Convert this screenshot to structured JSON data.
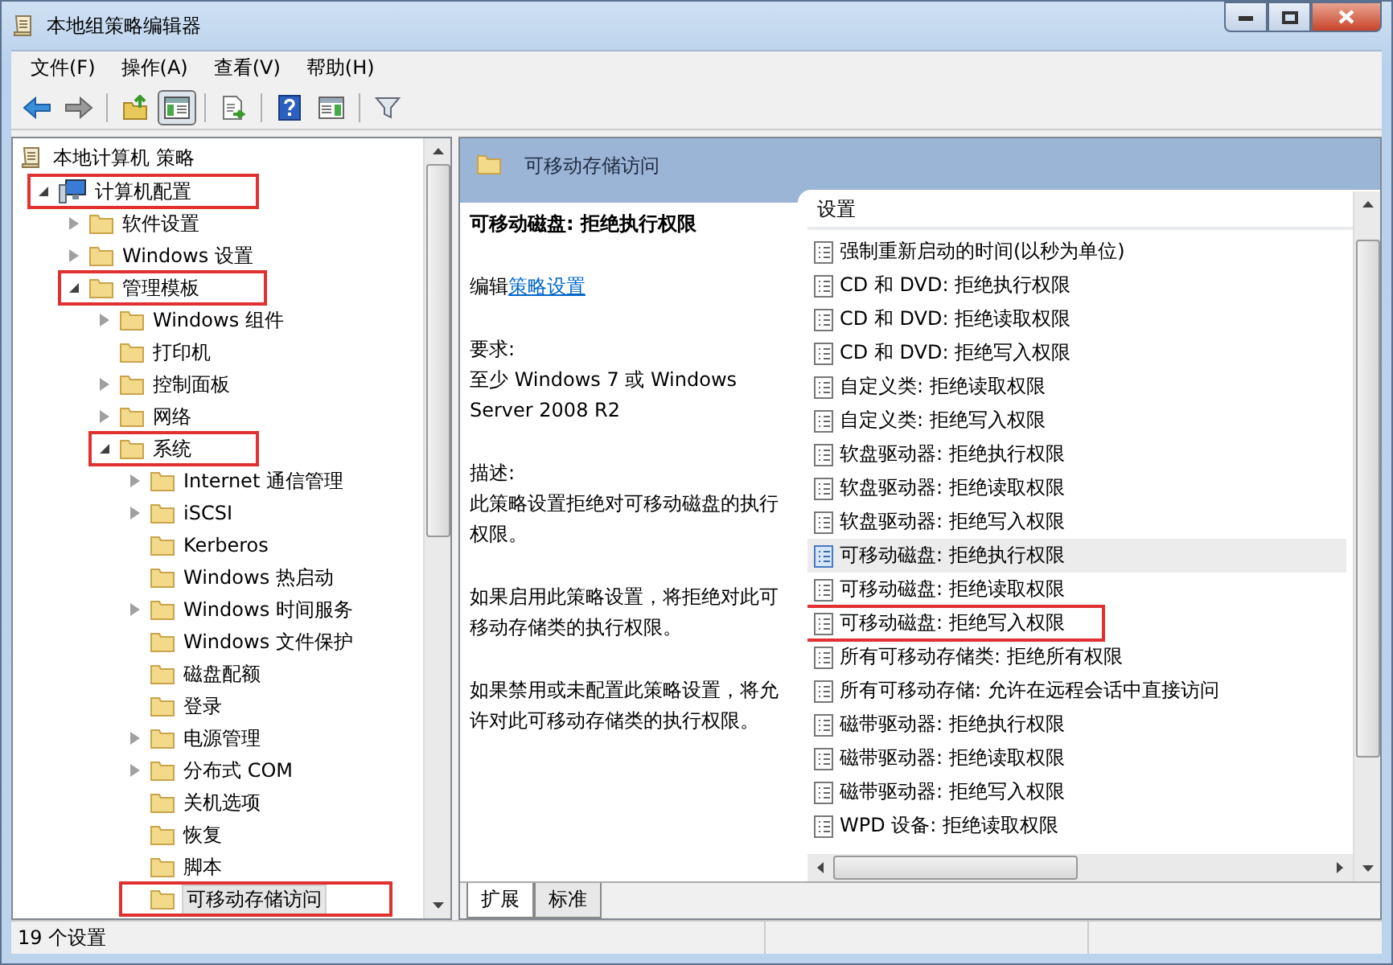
{
  "window": {
    "title": "本地组策略编辑器"
  },
  "menu": [
    "文件(F)",
    "操作(A)",
    "查看(V)",
    "帮助(H)"
  ],
  "toolbar": [
    {
      "kind": "back",
      "pressed": false
    },
    {
      "kind": "forward",
      "pressed": false
    },
    {
      "kind": "sep"
    },
    {
      "kind": "up",
      "pressed": false
    },
    {
      "kind": "tree",
      "pressed": true
    },
    {
      "kind": "sep"
    },
    {
      "kind": "export",
      "pressed": false
    },
    {
      "kind": "sep"
    },
    {
      "kind": "help",
      "pressed": false
    },
    {
      "kind": "pane",
      "pressed": false
    },
    {
      "kind": "sep"
    },
    {
      "kind": "filter",
      "pressed": false
    }
  ],
  "tree": {
    "label": "本地计算机 策略",
    "children": [
      {
        "label": "计算机配置",
        "kind": "computer",
        "expanded": true,
        "highlighted": true,
        "selected": false,
        "children": [
          {
            "label": "软件设置",
            "kind": "folder",
            "expanded": false,
            "highlighted": false,
            "selected": false,
            "expandable": true
          },
          {
            "label": "Windows 设置",
            "kind": "folder",
            "expanded": false,
            "highlighted": false,
            "selected": false,
            "expandable": true
          },
          {
            "label": "管理模板",
            "kind": "folder",
            "expanded": true,
            "highlighted": true,
            "selected": false,
            "children": [
              {
                "label": "Windows 组件",
                "kind": "folder",
                "expanded": false,
                "highlighted": false,
                "selected": false,
                "expandable": true
              },
              {
                "label": "打印机",
                "kind": "folder",
                "expanded": false,
                "highlighted": false,
                "selected": false,
                "expandable": false
              },
              {
                "label": "控制面板",
                "kind": "folder",
                "expanded": false,
                "highlighted": false,
                "selected": false,
                "expandable": true
              },
              {
                "label": "网络",
                "kind": "folder",
                "expanded": false,
                "highlighted": false,
                "selected": false,
                "expandable": true
              },
              {
                "label": "系统",
                "kind": "folder",
                "expanded": true,
                "highlighted": true,
                "selected": false,
                "children": [
                  {
                    "label": "Internet 通信管理",
                    "kind": "folder",
                    "expanded": false,
                    "highlighted": false,
                    "selected": false,
                    "expandable": true
                  },
                  {
                    "label": "iSCSI",
                    "kind": "folder",
                    "expanded": false,
                    "highlighted": false,
                    "selected": false,
                    "expandable": true
                  },
                  {
                    "label": "Kerberos",
                    "kind": "folder",
                    "expanded": false,
                    "highlighted": false,
                    "selected": false,
                    "expandable": false
                  },
                  {
                    "label": "Windows 热启动",
                    "kind": "folder",
                    "expanded": false,
                    "highlighted": false,
                    "selected": false,
                    "expandable": false
                  },
                  {
                    "label": "Windows 时间服务",
                    "kind": "folder",
                    "expanded": false,
                    "highlighted": false,
                    "selected": false,
                    "expandable": true
                  },
                  {
                    "label": "Windows 文件保护",
                    "kind": "folder",
                    "expanded": false,
                    "highlighted": false,
                    "selected": false,
                    "expandable": false
                  },
                  {
                    "label": "磁盘配额",
                    "kind": "folder",
                    "expanded": false,
                    "highlighted": false,
                    "selected": false,
                    "expandable": false
                  },
                  {
                    "label": "登录",
                    "kind": "folder",
                    "expanded": false,
                    "highlighted": false,
                    "selected": false,
                    "expandable": false
                  },
                  {
                    "label": "电源管理",
                    "kind": "folder",
                    "expanded": false,
                    "highlighted": false,
                    "selected": false,
                    "expandable": true
                  },
                  {
                    "label": "分布式 COM",
                    "kind": "folder",
                    "expanded": false,
                    "highlighted": false,
                    "selected": false,
                    "expandable": true
                  },
                  {
                    "label": "关机选项",
                    "kind": "folder",
                    "expanded": false,
                    "highlighted": false,
                    "selected": false,
                    "expandable": false
                  },
                  {
                    "label": "恢复",
                    "kind": "folder",
                    "expanded": false,
                    "highlighted": false,
                    "selected": false,
                    "expandable": false
                  },
                  {
                    "label": "脚本",
                    "kind": "folder",
                    "expanded": false,
                    "highlighted": false,
                    "selected": false,
                    "expandable": false
                  },
                  {
                    "label": "可移动存储访问",
                    "kind": "folder",
                    "expanded": false,
                    "highlighted": true,
                    "selected": true,
                    "expandable": false
                  }
                ]
              }
            ]
          }
        ]
      }
    ]
  },
  "detail": {
    "header": "可移动存储访问",
    "title": "可移动磁盘: 拒绝执行权限",
    "edit_prefix": "编辑",
    "edit_link": "策略设置",
    "requirements_label": "要求:",
    "requirements": "至少 Windows 7 或 Windows Server 2008 R2",
    "description_label": "描述:",
    "paragraphs": [
      "此策略设置拒绝对可移动磁盘的执行权限。",
      "如果启用此策略设置，将拒绝对此可移动存储类的执行权限。",
      "如果禁用或未配置此策略设置，将允许对此可移动存储类的执行权限。"
    ]
  },
  "settings": {
    "column": "设置",
    "items": [
      {
        "label": "强制重新启动的时间(以秒为单位)",
        "selected": false,
        "highlighted": false
      },
      {
        "label": "CD 和 DVD: 拒绝执行权限",
        "selected": false,
        "highlighted": false
      },
      {
        "label": "CD 和 DVD: 拒绝读取权限",
        "selected": false,
        "highlighted": false
      },
      {
        "label": "CD 和 DVD: 拒绝写入权限",
        "selected": false,
        "highlighted": false
      },
      {
        "label": "自定义类: 拒绝读取权限",
        "selected": false,
        "highlighted": false
      },
      {
        "label": "自定义类: 拒绝写入权限",
        "selected": false,
        "highlighted": false
      },
      {
        "label": "软盘驱动器: 拒绝执行权限",
        "selected": false,
        "highlighted": false
      },
      {
        "label": "软盘驱动器: 拒绝读取权限",
        "selected": false,
        "highlighted": false
      },
      {
        "label": "软盘驱动器: 拒绝写入权限",
        "selected": false,
        "highlighted": false
      },
      {
        "label": "可移动磁盘: 拒绝执行权限",
        "selected": true,
        "highlighted": false
      },
      {
        "label": "可移动磁盘: 拒绝读取权限",
        "selected": false,
        "highlighted": false
      },
      {
        "label": "可移动磁盘: 拒绝写入权限",
        "selected": false,
        "highlighted": true
      },
      {
        "label": "所有可移动存储类: 拒绝所有权限",
        "selected": false,
        "highlighted": false
      },
      {
        "label": "所有可移动存储: 允许在远程会话中直接访问",
        "selected": false,
        "highlighted": false
      },
      {
        "label": "磁带驱动器: 拒绝执行权限",
        "selected": false,
        "highlighted": false
      },
      {
        "label": "磁带驱动器: 拒绝读取权限",
        "selected": false,
        "highlighted": false
      },
      {
        "label": "磁带驱动器: 拒绝写入权限",
        "selected": false,
        "highlighted": false
      },
      {
        "label": "WPD 设备: 拒绝读取权限",
        "selected": false,
        "highlighted": false
      }
    ]
  },
  "tabs": [
    {
      "label": "扩展",
      "selected": true
    },
    {
      "label": "标准",
      "selected": false
    }
  ],
  "status_bar": "19 个设置"
}
